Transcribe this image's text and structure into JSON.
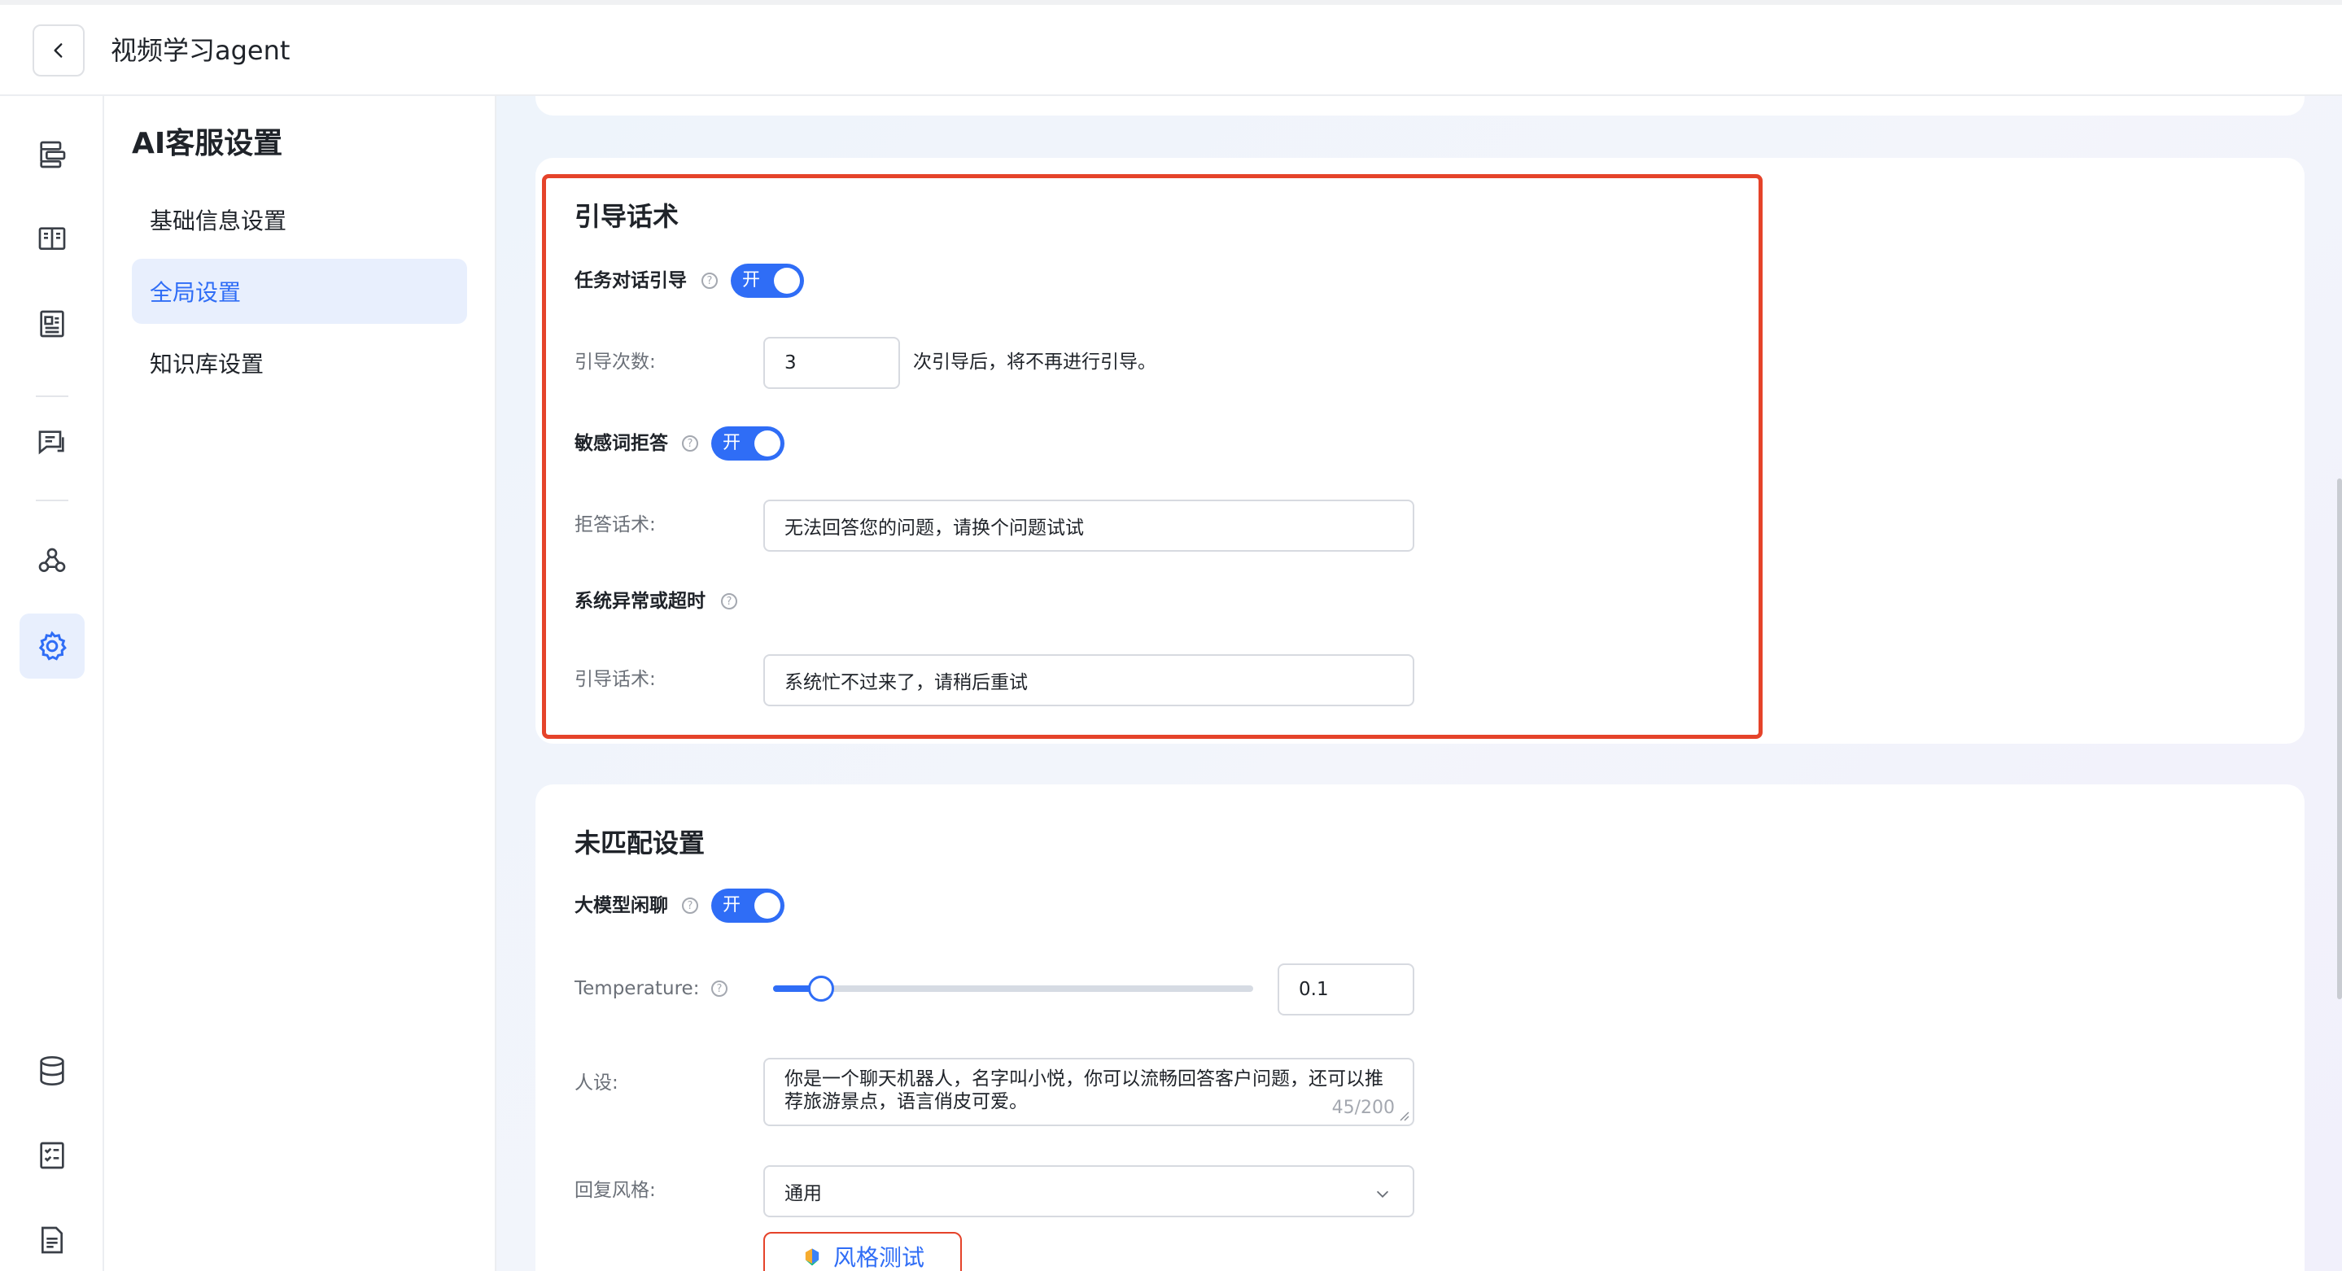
{
  "header": {
    "title": "视频学习agent"
  },
  "rail": {
    "items": [
      {
        "icon": "workflow-icon",
        "active": false
      },
      {
        "icon": "book-icon",
        "active": false
      },
      {
        "icon": "document-icon",
        "active": false
      },
      {
        "icon": "chat-icon",
        "active": false
      },
      {
        "icon": "nodes-icon",
        "active": false
      },
      {
        "icon": "gear-icon",
        "active": true
      },
      {
        "icon": "database-icon",
        "active": false
      },
      {
        "icon": "checklist-icon",
        "active": false
      },
      {
        "icon": "file-icon",
        "active": false
      }
    ]
  },
  "nav": {
    "title": "AI客服设置",
    "items": [
      {
        "label": "基础信息设置",
        "active": false
      },
      {
        "label": "全局设置",
        "active": true
      },
      {
        "label": "知识库设置",
        "active": false
      }
    ]
  },
  "guide": {
    "title": "引导话术",
    "task_guide_label": "任务对话引导",
    "task_guide_toggle": "开",
    "guide_count_label": "引导次数:",
    "guide_count_value": "3",
    "guide_count_suffix": "次引导后，将不再进行引导。",
    "sensitive_label": "敏感词拒答",
    "sensitive_toggle": "开",
    "refuse_label": "拒答话术:",
    "refuse_value": "无法回答您的问题，请换个问题试试",
    "error_label": "系统异常或超时",
    "error_guide_label": "引导话术:",
    "error_guide_value": "系统忙不过来了，请稍后重试"
  },
  "unmatched": {
    "title": "未匹配设置",
    "chat_label": "大模型闲聊",
    "chat_toggle": "开",
    "temperature_label": "Temperature:",
    "temperature_value": "0.1",
    "temperature_fraction": 0.1,
    "persona_label": "人设:",
    "persona_value": "你是一个聊天机器人，名字叫小悦，你可以流畅回答客户问题，还可以推荐旅游景点，语言俏皮可爱。",
    "persona_counter": "45/200",
    "reply_style_label": "回复风格:",
    "reply_style_value": "通用",
    "style_test_button": "风格测试"
  },
  "colors": {
    "accent": "#2f6df6",
    "highlight_border": "#e5432a",
    "active_bg": "#e8effd"
  }
}
